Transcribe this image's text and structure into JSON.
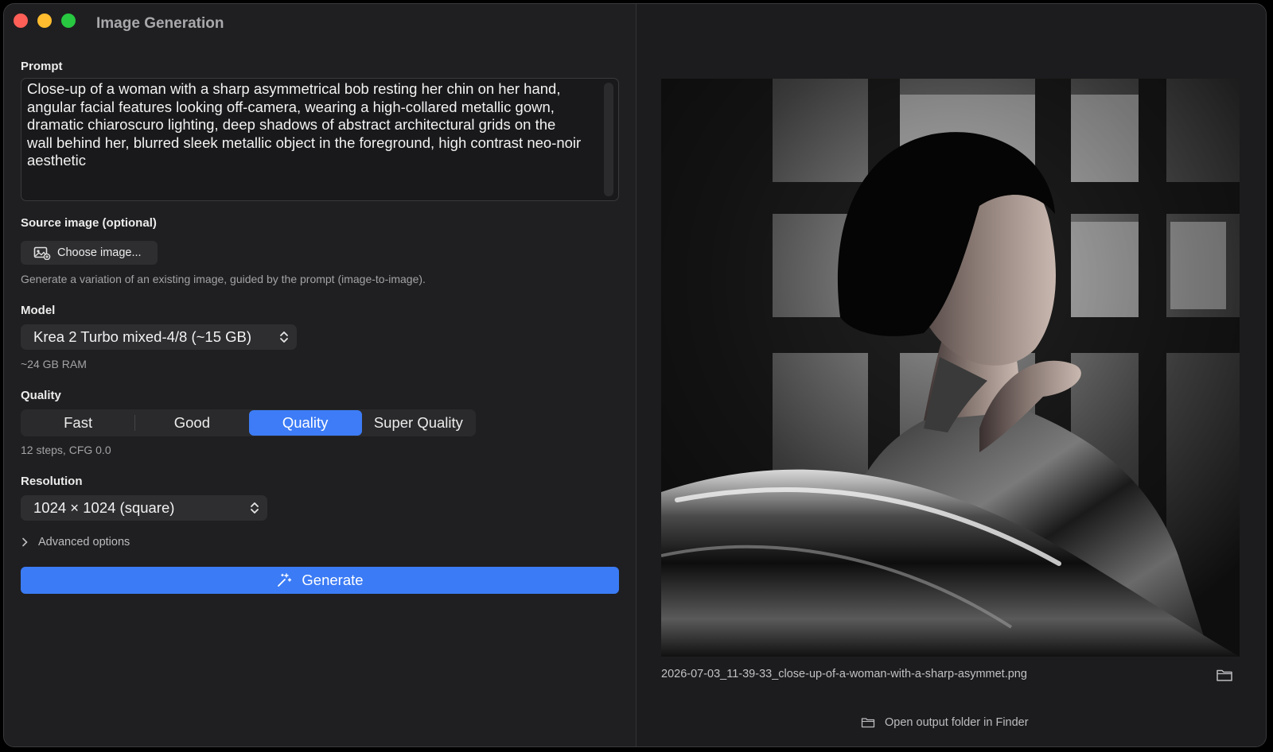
{
  "window": {
    "title": "Image Generation",
    "traffic_lights": [
      "close",
      "minimize",
      "zoom"
    ]
  },
  "prompt": {
    "label": "Prompt",
    "text": "Close-up of a woman with a sharp asymmetrical bob resting her chin on her hand, angular facial features looking off-camera, wearing a high-collared metallic gown, dramatic chiaroscuro lighting, deep shadows of abstract architectural grids on the wall behind her, blurred sleek metallic object in the foreground, high contrast neo-noir aesthetic"
  },
  "source_image": {
    "label": "Source image (optional)",
    "button_label": "Choose image...",
    "button_icon": "photo-icon",
    "help": "Generate a variation of an existing image, guided by the prompt (image-to-image)."
  },
  "model": {
    "label": "Model",
    "selected": "Krea 2 Turbo mixed-4/8 (~15 GB)",
    "note": "~24 GB RAM"
  },
  "quality": {
    "label": "Quality",
    "options": [
      "Fast",
      "Good",
      "Quality",
      "Super Quality"
    ],
    "selected": "Quality",
    "note": "12 steps, CFG 0.0"
  },
  "resolution": {
    "label": "Resolution",
    "selected": "1024 × 1024 (square)"
  },
  "advanced": {
    "label": "Advanced options"
  },
  "generate": {
    "label": "Generate",
    "icon": "magic-wand-icon"
  },
  "output": {
    "filename": "2026-07-03_11-39-33_close-up-of-a-woman-with-a-sharp-asymmet.png",
    "open_folder_label": "Open output folder in Finder"
  },
  "colors": {
    "accent": "#3b7bf5",
    "window_bg": "#1c1c1e",
    "close": "#ff5f57",
    "minimize": "#febc2e",
    "zoom": "#28c840"
  }
}
